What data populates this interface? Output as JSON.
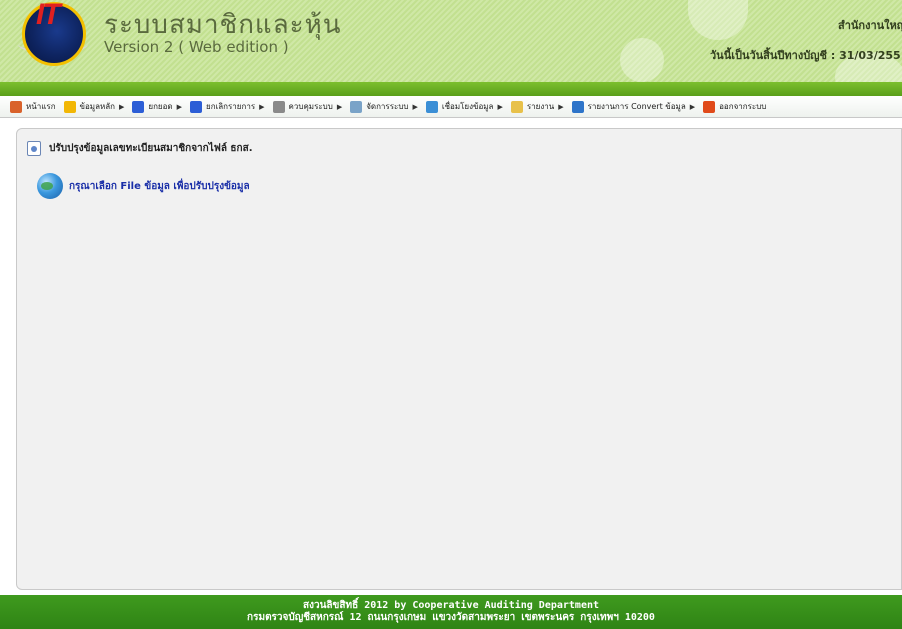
{
  "header": {
    "app_title": "ระบบสมาชิกและหุ้น",
    "app_version": "Version 2 ( Web edition )",
    "office": "สำนักงานใหญ",
    "fiscal_label": "วันนี้เป็นวันสิ้นปีทางบัญชี : 31/03/255",
    "logo_text": "IT"
  },
  "menu": {
    "items": [
      {
        "label": "หน้าแรก",
        "icon": "home-icon",
        "color": "#d9622b",
        "submenu": false
      },
      {
        "label": "ข้อมูลหลัก",
        "icon": "star-icon",
        "color": "#f2b705",
        "submenu": true
      },
      {
        "label": "ยกยอด",
        "icon": "save-icon",
        "color": "#2c5ed6",
        "submenu": true
      },
      {
        "label": "ยกเลิกรายการ",
        "icon": "cancel-save-icon",
        "color": "#2c5ed6",
        "submenu": true
      },
      {
        "label": "ควบคุมระบบ",
        "icon": "gear-icon",
        "color": "#8a8a8a",
        "submenu": true
      },
      {
        "label": "จัดการระบบ",
        "icon": "gears-icon",
        "color": "#7aa3c8",
        "submenu": true
      },
      {
        "label": "เชื่อมโยงข้อมูล",
        "icon": "window-icon",
        "color": "#3b8fd6",
        "submenu": true
      },
      {
        "label": "รายงาน",
        "icon": "folder-icon",
        "color": "#e8c14a",
        "submenu": true
      },
      {
        "label": "รายงานการ Convert ข้อมูล",
        "icon": "convert-icon",
        "color": "#2e74c9",
        "submenu": true
      },
      {
        "label": "ออกจากระบบ",
        "icon": "exit-icon",
        "color": "#e04a1a",
        "submenu": false
      }
    ]
  },
  "main": {
    "heading": "ปรับปรุงข้อมูลเลขทะเบียนสมาชิกจากไฟล์ ธกส.",
    "select_link": "กรุณาเลือก File ข้อมูล เพื่อปรับปรุงข้อมูล"
  },
  "footer": {
    "line1": "สงวนลิขสิทธิ์ 2012 by Cooperative Auditing Department",
    "line2": "กรมตรวจบัญชีสหกรณ์ 12 ถนนกรุงเกษม แขวงวัดสามพระยา เขตพระนคร กรุงเทพฯ 10200"
  },
  "colors": {
    "header_bg": "#c8e49a",
    "footer_bg": "#3a9119",
    "link": "#1a2fa8"
  }
}
